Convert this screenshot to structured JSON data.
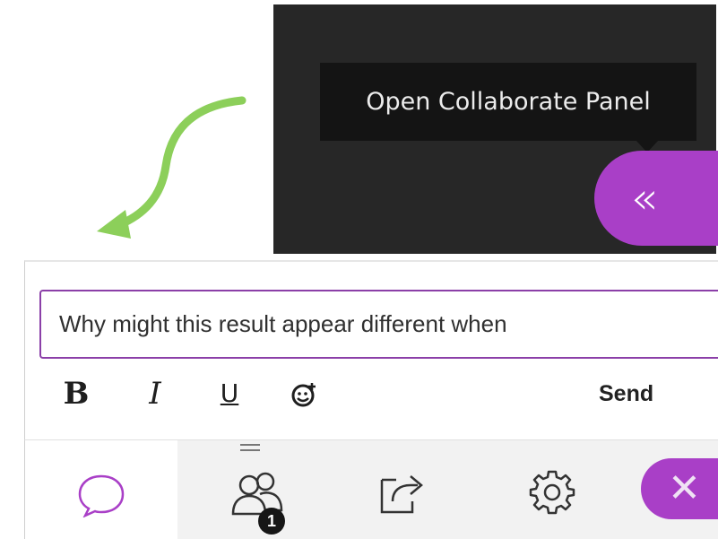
{
  "tooltip": {
    "text": "Open Collaborate Panel"
  },
  "open_panel_button": {
    "icon": "double-chevron-left-icon",
    "glyph": "«"
  },
  "composer": {
    "message_value": "Why might this result appear different when",
    "bold_label": "B",
    "italic_label": "I",
    "underline_label": "U",
    "emoji_icon": "emoji-plus-icon",
    "send_label": "Send"
  },
  "toolbar": {
    "chat_icon": "chat-bubble-icon",
    "participants_icon": "participants-icon",
    "participant_count": "1",
    "share_icon": "share-content-icon",
    "settings_icon": "gear-icon",
    "close_icon": "close-icon",
    "close_glyph": "✕"
  },
  "colors": {
    "accent": "#a93fc7",
    "dark_panel": "#272727",
    "tooltip_bg": "#141414",
    "hint_arrow": "#8ccf5a",
    "input_border": "#8b3fa8"
  }
}
